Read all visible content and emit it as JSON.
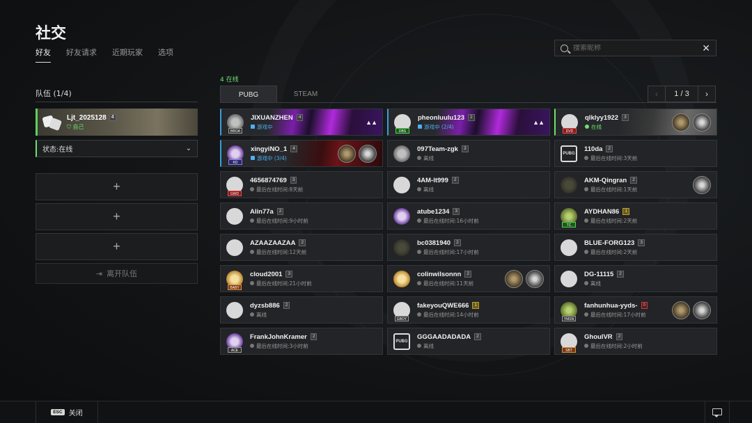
{
  "page": {
    "title": "社交"
  },
  "tabs": [
    {
      "label": "好友",
      "active": true
    },
    {
      "label": "好友请求",
      "active": false
    },
    {
      "label": "近期玩家",
      "active": false
    },
    {
      "label": "选项",
      "active": false
    }
  ],
  "search": {
    "placeholder": "搜索昵称",
    "value": ""
  },
  "team": {
    "title": "队伍 (1/4)",
    "me": {
      "name": "Ljt_2025128",
      "level": "4",
      "status": "自己"
    },
    "status_dropdown": "状态:在线",
    "empty_slots": [
      "+",
      "+",
      "+"
    ],
    "leave_label": "离开队伍"
  },
  "friends_panel": {
    "online_count": "4 在线",
    "platform_tabs": [
      {
        "label": "PUBG",
        "active": true
      },
      {
        "label": "STEAM",
        "active": false
      }
    ],
    "pager": {
      "text": "1 / 3",
      "prev": "‹",
      "next": "›"
    },
    "friends": [
      {
        "name": "JIXUANZHEN",
        "level": "4",
        "status": "游戏中",
        "state": "ingame",
        "avatar": "grey",
        "tag": "BBOA",
        "tagc": "",
        "style": "c0",
        "squad": true
      },
      {
        "name": "pheonluulu123",
        "level": "2",
        "status": "游戏中 (2/4)",
        "state": "ingame",
        "avatar": "circle",
        "tag": "DBS",
        "tagc": "grn",
        "style": "c0",
        "squad": true
      },
      {
        "name": "qlklyy1922",
        "level": "3",
        "status": "在线",
        "state": "online-ingame",
        "avatar": "circle",
        "tag": "DVD",
        "tagc": "red",
        "style": "c2",
        "squad": false
      },
      {
        "name": "xingyiNO_1",
        "level": "4",
        "status": "游戏中 (3/4)",
        "state": "ingame",
        "avatar": "purple",
        "tag": "KD",
        "tagc": "blu",
        "style": "c3",
        "squad": false
      },
      {
        "name": "097Team-zgk",
        "level": "3",
        "status": "离线",
        "state": "offline",
        "avatar": "grey",
        "tag": "",
        "tagc": "",
        "style": "",
        "squad": false
      },
      {
        "name": "110da",
        "level": "2",
        "status": "最后在线时间:3天前",
        "state": "offline",
        "avatar": "pubg",
        "tag": "",
        "tagc": "",
        "style": "",
        "squad": false
      },
      {
        "name": "4656874769",
        "level": "3",
        "status": "最后在线时间:8天前",
        "state": "offline",
        "avatar": "circle",
        "tag": "GWD",
        "tagc": "red",
        "style": "",
        "squad": false
      },
      {
        "name": "4AM-lt999",
        "level": "2",
        "status": "离线",
        "state": "offline",
        "avatar": "circle",
        "tag": "",
        "tagc": "",
        "style": "",
        "squad": false
      },
      {
        "name": "AKM-Qingran",
        "level": "2",
        "status": "最后在线时间:1天前",
        "state": "offline",
        "avatar": "dark",
        "tag": "",
        "tagc": "",
        "style": "",
        "squad": false
      },
      {
        "name": "Alin77a",
        "level": "2",
        "status": "最后在线时间:9小时前",
        "state": "offline",
        "avatar": "circle",
        "tag": "",
        "tagc": "",
        "style": "",
        "squad": false
      },
      {
        "name": "atube1234",
        "level": "3",
        "status": "最后在线时间:16小时前",
        "state": "offline",
        "avatar": "purple",
        "tag": "",
        "tagc": "",
        "style": "",
        "squad": false
      },
      {
        "name": "AYDHAN86",
        "level": "1",
        "status": "最后在线时间:2天前",
        "state": "offline",
        "avatar": "green",
        "tag": "TC",
        "tagc": "grn",
        "style": "",
        "squad": false
      },
      {
        "name": "AZAAZAAZAA",
        "level": "2",
        "status": "最后在线时间:12天前",
        "state": "offline",
        "avatar": "circle",
        "tag": "",
        "tagc": "",
        "style": "",
        "squad": false
      },
      {
        "name": "bc0381940",
        "level": "2",
        "status": "最后在线时间:17小时前",
        "state": "offline",
        "avatar": "dark",
        "tag": "",
        "tagc": "",
        "style": "",
        "squad": false
      },
      {
        "name": "BLUE-FORG123",
        "level": "3",
        "status": "最后在线时间:2天前",
        "state": "offline",
        "avatar": "circle",
        "tag": "",
        "tagc": "",
        "style": "",
        "squad": false
      },
      {
        "name": "cloud2001",
        "level": "3",
        "status": "最后在线时间:21小时前",
        "state": "offline",
        "avatar": "gold",
        "tag": "BABY",
        "tagc": "org",
        "style": "",
        "squad": false
      },
      {
        "name": "colinwilsonnn",
        "level": "2",
        "status": "最后在线时间:11天前",
        "state": "offline",
        "avatar": "gold",
        "tag": "",
        "tagc": "",
        "style": "",
        "squad": false
      },
      {
        "name": "DG-11115",
        "level": "2",
        "status": "离线",
        "state": "offline",
        "avatar": "circle",
        "tag": "",
        "tagc": "",
        "style": "",
        "squad": false
      },
      {
        "name": "dyzsb886",
        "level": "2",
        "status": "离线",
        "state": "offline",
        "avatar": "circle",
        "tag": "",
        "tagc": "",
        "style": "",
        "squad": false
      },
      {
        "name": "fakeyouQWE666",
        "level": "1",
        "status": "最后在线时间:14小时前",
        "state": "offline",
        "avatar": "circle",
        "tag": "GBOY",
        "tagc": "",
        "style": "",
        "squad": false
      },
      {
        "name": "fanhunhua-yyds-",
        "level": "0",
        "status": "最后在线时间:17小时前",
        "state": "offline",
        "avatar": "green",
        "tag": "YMSN",
        "tagc": "",
        "style": "",
        "squad": false
      },
      {
        "name": "FrankJohnKramer",
        "level": "2",
        "status": "最后在线时间:3小时前",
        "state": "offline",
        "avatar": "purple",
        "tag": "ACE",
        "tagc": "",
        "style": "",
        "squad": false
      },
      {
        "name": "GGGAADADADA",
        "level": "2",
        "status": "离线",
        "state": "offline",
        "avatar": "pubg",
        "tag": "",
        "tagc": "",
        "style": "",
        "squad": false
      },
      {
        "name": "GhoulVR",
        "level": "2",
        "status": "最后在线时间:2小时前",
        "state": "offline",
        "avatar": "circle",
        "tag": "SBT",
        "tagc": "org",
        "style": "",
        "squad": false
      }
    ],
    "level_badges": {
      "gold": [
        "AYDHAN86",
        "fakeyouQWE666"
      ],
      "red": [
        "fanhunhua-yyds-"
      ]
    },
    "pubg_logo_text": "PUBG"
  },
  "bottom": {
    "esc_key": "ESC",
    "close_label": "关闭"
  }
}
